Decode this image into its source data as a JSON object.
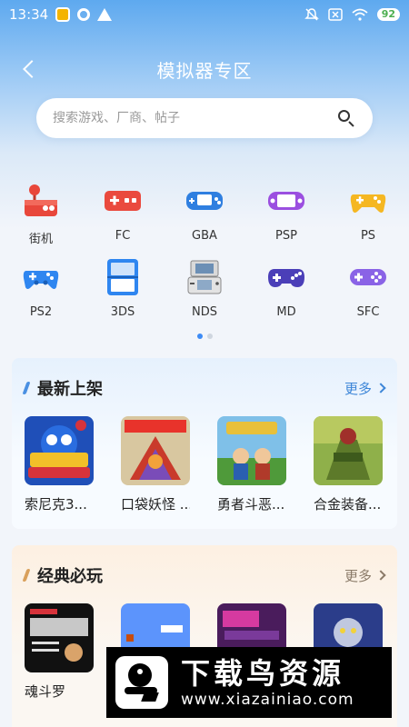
{
  "status_bar": {
    "time": "13:34",
    "battery": "92"
  },
  "header": {
    "title": "模拟器专区"
  },
  "search": {
    "placeholder": "搜索游戏、厂商、帖子"
  },
  "categories": [
    {
      "label": "街机",
      "icon": "arcade-stick-icon"
    },
    {
      "label": "FC",
      "icon": "fc-console-icon"
    },
    {
      "label": "GBA",
      "icon": "gba-handheld-icon"
    },
    {
      "label": "PSP",
      "icon": "psp-handheld-icon"
    },
    {
      "label": "PS",
      "icon": "ps-controller-icon"
    },
    {
      "label": "PS2",
      "icon": "ps2-controller-icon"
    },
    {
      "label": "3DS",
      "icon": "3ds-handheld-icon"
    },
    {
      "label": "NDS",
      "icon": "nds-handheld-icon"
    },
    {
      "label": "MD",
      "icon": "md-controller-icon"
    },
    {
      "label": "SFC",
      "icon": "sfc-controller-icon"
    }
  ],
  "pager": {
    "pages": 2,
    "active": 1
  },
  "section_new": {
    "title": "最新上架",
    "more": "更多",
    "games": [
      {
        "name": "索尼克3...",
        "cover_color": "#1f4fb8"
      },
      {
        "name": "口袋妖怪 ...",
        "cover_color": "#c93a2b"
      },
      {
        "name": "勇者斗恶...",
        "cover_color": "#4f9a3a"
      },
      {
        "name": "合金装备...",
        "cover_color": "#5d7a2a"
      }
    ]
  },
  "section_classic": {
    "title": "经典必玩",
    "more": "更多",
    "games": [
      {
        "name": "魂斗罗",
        "cover_color": "#111111"
      },
      {
        "name": "",
        "cover_color": "#5c94fc"
      },
      {
        "name": "",
        "cover_color": "#4a1c5c"
      },
      {
        "name": "",
        "cover_color": "#2b3d8a"
      }
    ]
  },
  "watermark": {
    "title": "下载鸟资源",
    "url": "www.xiazainiao.com"
  },
  "colors": {
    "accent": "#3d8bf5",
    "header_blue": "#5ea9ef"
  }
}
